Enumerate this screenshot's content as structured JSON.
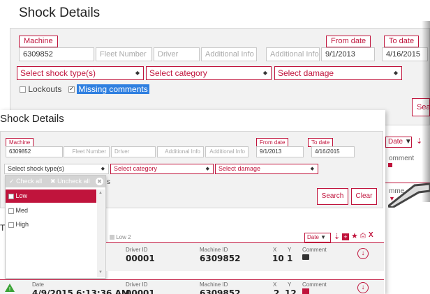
{
  "back": {
    "title": "Shock Details",
    "machine_label": "Machine",
    "machine_value": "6309852",
    "fleet_placeholder": "Fleet Number",
    "driver_placeholder": "Driver",
    "additional1_placeholder": "Additional Info",
    "additional2_placeholder": "Additional Info",
    "from_label": "From date",
    "from_value": "9/1/2013",
    "to_label": "To date",
    "to_value": "4/16/2015",
    "shock_type": "Select shock type(s)",
    "category": "Select category",
    "damage": "Select damage",
    "lockouts": "Lockouts",
    "missing_comments": "Missing comments",
    "search_partial": "Sear"
  },
  "right_peek": {
    "date_btn": "Date",
    "comment1": "omment",
    "comment2": "mme"
  },
  "front": {
    "title": "Shock Details",
    "machine_label": "Machine",
    "machine_value": "6309852",
    "fleet_placeholder": "Fleet Number",
    "driver_placeholder": "Driver",
    "additional1_placeholder": "Additional Info",
    "additional2_placeholder": "Additional Info",
    "from_label": "From date",
    "from_value": "9/1/2013",
    "to_label": "To date",
    "to_value": "4/16/2015",
    "shock_type": "Select shock type(s)",
    "category": "Select category",
    "damage": "Select damage",
    "search": "Search",
    "clear": "Clear",
    "partial_s": "s",
    "partial_T": "T",
    "low_count": "Low 2",
    "date_btn": "Date"
  },
  "dropdown": {
    "check_all": "Check all",
    "uncheck_all": "Uncheck all",
    "options": [
      "Low",
      "Med",
      "High"
    ]
  },
  "results": {
    "headers": {
      "date": "Date",
      "driver": "Driver ID",
      "machine": "Machine ID",
      "x": "X",
      "y": "Y",
      "comment": "Comment"
    },
    "rows": [
      {
        "date": "",
        "driver": "00001",
        "machine": "6309852",
        "x": "10",
        "y": "1"
      },
      {
        "date": "4/9/2015 6:13:36 AM",
        "driver": "00001",
        "machine": "6309852",
        "x": "2",
        "y": "12"
      }
    ]
  },
  "colors": {
    "accent": "#c0143c"
  }
}
